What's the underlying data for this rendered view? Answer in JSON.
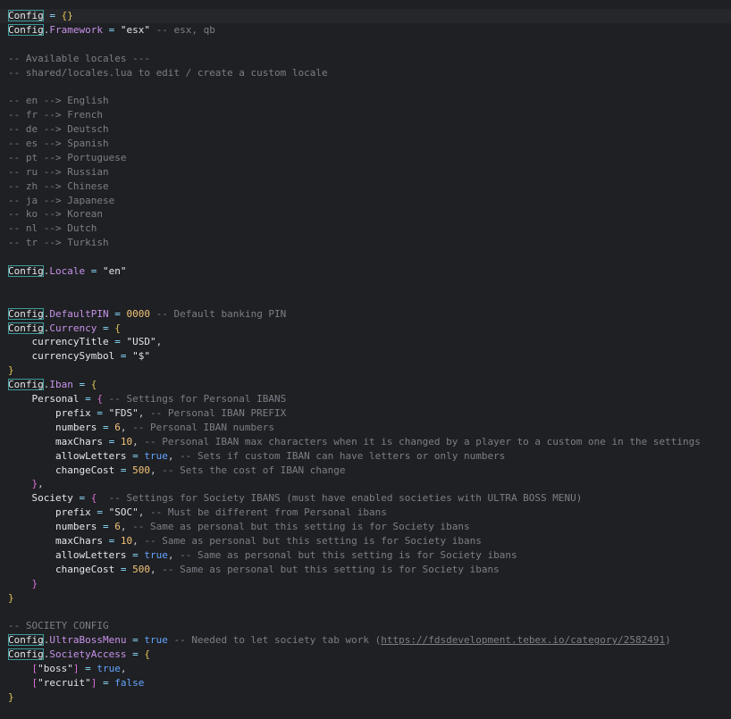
{
  "editor": {
    "lines": [
      {
        "tokens": [
          {
            "t": "Config",
            "c": "tok-config"
          },
          {
            "t": " = ",
            "c": "op"
          },
          {
            "t": "{}",
            "c": "brace"
          }
        ],
        "current": true
      },
      {
        "tokens": [
          {
            "t": "Config",
            "c": "tok-config"
          },
          {
            "t": ".",
            "c": "dot"
          },
          {
            "t": "Framework",
            "c": "prop"
          },
          {
            "t": " = ",
            "c": "op"
          },
          {
            "t": "\"esx\"",
            "c": "str"
          },
          {
            "t": " -- esx, qb",
            "c": "comment"
          }
        ]
      },
      {
        "tokens": []
      },
      {
        "tokens": [
          {
            "t": "-- Available locales ---",
            "c": "comment"
          }
        ]
      },
      {
        "tokens": [
          {
            "t": "-- shared/locales.lua to edit / create a custom locale",
            "c": "comment"
          }
        ]
      },
      {
        "tokens": []
      },
      {
        "tokens": [
          {
            "t": "-- en --> English",
            "c": "comment"
          }
        ]
      },
      {
        "tokens": [
          {
            "t": "-- fr --> French",
            "c": "comment"
          }
        ]
      },
      {
        "tokens": [
          {
            "t": "-- de --> Deutsch",
            "c": "comment"
          }
        ]
      },
      {
        "tokens": [
          {
            "t": "-- es --> Spanish",
            "c": "comment"
          }
        ]
      },
      {
        "tokens": [
          {
            "t": "-- pt --> Portuguese",
            "c": "comment"
          }
        ]
      },
      {
        "tokens": [
          {
            "t": "-- ru --> Russian",
            "c": "comment"
          }
        ]
      },
      {
        "tokens": [
          {
            "t": "-- zh --> Chinese",
            "c": "comment"
          }
        ]
      },
      {
        "tokens": [
          {
            "t": "-- ja --> Japanese",
            "c": "comment"
          }
        ]
      },
      {
        "tokens": [
          {
            "t": "-- ko --> Korean",
            "c": "comment"
          }
        ]
      },
      {
        "tokens": [
          {
            "t": "-- nl --> Dutch",
            "c": "comment"
          }
        ]
      },
      {
        "tokens": [
          {
            "t": "-- tr --> Turkish",
            "c": "comment"
          }
        ]
      },
      {
        "tokens": []
      },
      {
        "tokens": [
          {
            "t": "Config",
            "c": "tok-config"
          },
          {
            "t": ".",
            "c": "dot"
          },
          {
            "t": "Locale",
            "c": "prop"
          },
          {
            "t": " = ",
            "c": "op"
          },
          {
            "t": "\"en\"",
            "c": "str"
          }
        ]
      },
      {
        "tokens": []
      },
      {
        "tokens": []
      },
      {
        "tokens": [
          {
            "t": "Config",
            "c": "tok-config"
          },
          {
            "t": ".",
            "c": "dot"
          },
          {
            "t": "DefaultPIN",
            "c": "prop"
          },
          {
            "t": " = ",
            "c": "op"
          },
          {
            "t": "0000",
            "c": "num"
          },
          {
            "t": " -- Default banking PIN",
            "c": "comment"
          }
        ]
      },
      {
        "tokens": [
          {
            "t": "Config",
            "c": "tok-config"
          },
          {
            "t": ".",
            "c": "dot"
          },
          {
            "t": "Currency",
            "c": "prop"
          },
          {
            "t": " = ",
            "c": "op"
          },
          {
            "t": "{",
            "c": "brace"
          }
        ]
      },
      {
        "tokens": [
          {
            "t": "    currencyTitle",
            "c": "key"
          },
          {
            "t": " = ",
            "c": "op"
          },
          {
            "t": "\"USD\"",
            "c": "str"
          },
          {
            "t": ",",
            "c": "dot"
          }
        ]
      },
      {
        "tokens": [
          {
            "t": "    currencySymbol",
            "c": "key"
          },
          {
            "t": " = ",
            "c": "op"
          },
          {
            "t": "\"$\"",
            "c": "str"
          }
        ]
      },
      {
        "tokens": [
          {
            "t": "}",
            "c": "brace"
          }
        ]
      },
      {
        "tokens": [
          {
            "t": "Config",
            "c": "tok-config"
          },
          {
            "t": ".",
            "c": "dot"
          },
          {
            "t": "Iban",
            "c": "prop"
          },
          {
            "t": " = ",
            "c": "op"
          },
          {
            "t": "{",
            "c": "brace"
          }
        ]
      },
      {
        "tokens": [
          {
            "t": "    Personal",
            "c": "key"
          },
          {
            "t": " = ",
            "c": "op"
          },
          {
            "t": "{",
            "c": "brace2"
          },
          {
            "t": " -- Settings for Personal IBANS",
            "c": "comment"
          }
        ]
      },
      {
        "tokens": [
          {
            "t": "        prefix",
            "c": "key"
          },
          {
            "t": " = ",
            "c": "op"
          },
          {
            "t": "\"FDS\"",
            "c": "str"
          },
          {
            "t": ",",
            "c": "dot"
          },
          {
            "t": " -- Personal IBAN PREFIX",
            "c": "comment"
          }
        ]
      },
      {
        "tokens": [
          {
            "t": "        numbers",
            "c": "key"
          },
          {
            "t": " = ",
            "c": "op"
          },
          {
            "t": "6",
            "c": "num"
          },
          {
            "t": ",",
            "c": "dot"
          },
          {
            "t": " -- Personal IBAN numbers",
            "c": "comment"
          }
        ]
      },
      {
        "tokens": [
          {
            "t": "        maxChars",
            "c": "key"
          },
          {
            "t": " = ",
            "c": "op"
          },
          {
            "t": "10",
            "c": "num"
          },
          {
            "t": ",",
            "c": "dot"
          },
          {
            "t": " -- Personal IBAN max characters when it is changed by a player to a custom one in the settings",
            "c": "comment"
          }
        ]
      },
      {
        "tokens": [
          {
            "t": "        allowLetters",
            "c": "key"
          },
          {
            "t": " = ",
            "c": "op"
          },
          {
            "t": "true",
            "c": "bool"
          },
          {
            "t": ",",
            "c": "dot"
          },
          {
            "t": " -- Sets if custom IBAN can have letters or only numbers",
            "c": "comment"
          }
        ]
      },
      {
        "tokens": [
          {
            "t": "        changeCost",
            "c": "key"
          },
          {
            "t": " = ",
            "c": "op"
          },
          {
            "t": "500",
            "c": "num"
          },
          {
            "t": ",",
            "c": "dot"
          },
          {
            "t": " -- Sets the cost of IBAN change",
            "c": "comment"
          }
        ]
      },
      {
        "tokens": [
          {
            "t": "    }",
            "c": "brace2"
          },
          {
            "t": ",",
            "c": "dot"
          }
        ]
      },
      {
        "tokens": [
          {
            "t": "    Society",
            "c": "key"
          },
          {
            "t": " = ",
            "c": "op"
          },
          {
            "t": "{",
            "c": "brace2"
          },
          {
            "t": "  -- Settings for Society IBANS (must have enabled societies with ULTRA BOSS MENU)",
            "c": "comment"
          }
        ]
      },
      {
        "tokens": [
          {
            "t": "        prefix",
            "c": "key"
          },
          {
            "t": " = ",
            "c": "op"
          },
          {
            "t": "\"SOC\"",
            "c": "str"
          },
          {
            "t": ",",
            "c": "dot"
          },
          {
            "t": " -- Must be different from Personal ibans",
            "c": "comment"
          }
        ]
      },
      {
        "tokens": [
          {
            "t": "        numbers",
            "c": "key"
          },
          {
            "t": " = ",
            "c": "op"
          },
          {
            "t": "6",
            "c": "num"
          },
          {
            "t": ",",
            "c": "dot"
          },
          {
            "t": " -- Same as personal but this setting is for Society ibans",
            "c": "comment"
          }
        ]
      },
      {
        "tokens": [
          {
            "t": "        maxChars",
            "c": "key"
          },
          {
            "t": " = ",
            "c": "op"
          },
          {
            "t": "10",
            "c": "num"
          },
          {
            "t": ",",
            "c": "dot"
          },
          {
            "t": " -- Same as personal but this setting is for Society ibans",
            "c": "comment"
          }
        ]
      },
      {
        "tokens": [
          {
            "t": "        allowLetters",
            "c": "key"
          },
          {
            "t": " = ",
            "c": "op"
          },
          {
            "t": "true",
            "c": "bool"
          },
          {
            "t": ",",
            "c": "dot"
          },
          {
            "t": " -- Same as personal but this setting is for Society ibans",
            "c": "comment"
          }
        ]
      },
      {
        "tokens": [
          {
            "t": "        changeCost",
            "c": "key"
          },
          {
            "t": " = ",
            "c": "op"
          },
          {
            "t": "500",
            "c": "num"
          },
          {
            "t": ",",
            "c": "dot"
          },
          {
            "t": " -- Same as personal but this setting is for Society ibans",
            "c": "comment"
          }
        ]
      },
      {
        "tokens": [
          {
            "t": "    }",
            "c": "brace2"
          }
        ]
      },
      {
        "tokens": [
          {
            "t": "}",
            "c": "brace"
          }
        ]
      },
      {
        "tokens": []
      },
      {
        "tokens": [
          {
            "t": "-- SOCIETY CONFIG",
            "c": "comment"
          }
        ]
      },
      {
        "tokens": [
          {
            "t": "Config",
            "c": "tok-config"
          },
          {
            "t": ".",
            "c": "dot"
          },
          {
            "t": "UltraBossMenu",
            "c": "prop"
          },
          {
            "t": " = ",
            "c": "op"
          },
          {
            "t": "true",
            "c": "bool"
          },
          {
            "t": " -- Needed to let society tab work (",
            "c": "comment"
          },
          {
            "t": "https://fdsdevelopment.tebex.io/category/2582491",
            "c": "link"
          },
          {
            "t": ")",
            "c": "comment"
          }
        ]
      },
      {
        "tokens": [
          {
            "t": "Config",
            "c": "tok-config"
          },
          {
            "t": ".",
            "c": "dot"
          },
          {
            "t": "SocietyAccess",
            "c": "prop"
          },
          {
            "t": " = ",
            "c": "op"
          },
          {
            "t": "{",
            "c": "brace"
          }
        ]
      },
      {
        "tokens": [
          {
            "t": "    [",
            "c": "brace2"
          },
          {
            "t": "\"boss\"",
            "c": "str"
          },
          {
            "t": "]",
            "c": "brace2"
          },
          {
            "t": " = ",
            "c": "op"
          },
          {
            "t": "true",
            "c": "bool"
          },
          {
            "t": ",",
            "c": "dot"
          }
        ]
      },
      {
        "tokens": [
          {
            "t": "    [",
            "c": "brace2"
          },
          {
            "t": "\"recruit\"",
            "c": "str"
          },
          {
            "t": "]",
            "c": "brace2"
          },
          {
            "t": " = ",
            "c": "op"
          },
          {
            "t": "false",
            "c": "bool"
          }
        ]
      },
      {
        "tokens": [
          {
            "t": "}",
            "c": "brace"
          }
        ]
      }
    ]
  }
}
